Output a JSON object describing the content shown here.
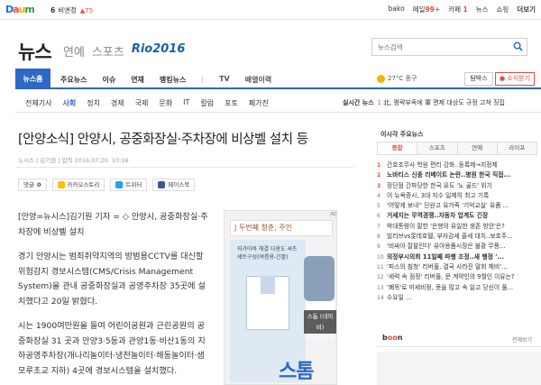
{
  "topbar": {
    "logo": {
      "d": "D",
      "a": "a",
      "u": "u",
      "m": "m"
    },
    "rank_num": "6",
    "rank_text": "비엔정",
    "rank_change": "▲75",
    "nav": [
      "bako",
      "메일",
      "99+",
      "카페",
      "1",
      "뉴스",
      "쇼핑",
      "더보기"
    ]
  },
  "header": {
    "brand": "뉴스",
    "sections": [
      "연예",
      "스포츠",
      "Rio2016"
    ],
    "search_placeholder": "뉴스검색"
  },
  "mainnav": {
    "home": "뉴스홈",
    "items": [
      "주요뉴스",
      "이슈",
      "연재",
      "랭킹뉴스",
      "|",
      "TV",
      "배열이력"
    ],
    "weather": "27°C 중구",
    "box_btn": "탐박스",
    "live_btn": "● 소식받기"
  },
  "subnav": {
    "items": [
      "전체기사",
      "사회",
      "정치",
      "경제",
      "국제",
      "문화",
      "IT",
      "칼럼",
      "포토",
      "페가진"
    ],
    "live_label": "실시간 뉴스",
    "live_num": "1",
    "live_text": "北, 평략부족에 軍 면제 대상도 규정 고쳐 징집"
  },
  "article": {
    "title": "[안양소식] 안양시, 공중화장실·주차장에 비상벨 설치 등",
    "meta": "뉴시스 | 김기원 | 입력 2016.07.20. 10:16",
    "share": {
      "comment": "댓글",
      "comment_count": "0",
      "kakao": "카카오스토리",
      "twitter": "트위터",
      "facebook": "페이스북"
    },
    "paragraphs": [
      "[안양=뉴시스]김기원 기자 = ◇ 안양시, 공중화장실·주차장에 비상벨 설치",
      "경기 안양시는 범죄취약지역의 방범용CCTV를 대신할 위험감지 경보시스템(CMS/Crisis Management System)을 관내 공중화장실과 공영주차장 35곳에 설치했다고 20일 밝혔다.",
      "시는 1900여만원을 들여 어린이공원과 근린공원의 공중화장실 31 곳과 안양3·5동과 관양1동·비산1동의 지하공영주차장(개나리놀이터·냉천놀이터·해동놀이터·샘모루초교 지하) 4곳에 경보시스템을 설치했다."
    ]
  },
  "ad": {
    "badge": "AD",
    "banner_a": "J",
    "banner_b": "두번째 청춘, 주인",
    "shirt_label_1": "자가아바 해결 다용도 셔츠",
    "shirt_label_2": "세트구성(여름용-긴팔)",
    "price_1": "스톰 (네이비)",
    "price_2": "42,800 원",
    "big_text": "스톰"
  },
  "rightpanel": {
    "heading": "이시각 주요뉴스",
    "tabs": [
      "종합",
      "스포츠",
      "연예",
      "라이프"
    ],
    "items": [
      {
        "n": "1",
        "t": "간호조무사 학원 편리 강화..등록제→지정제"
      },
      {
        "n": "2",
        "t": "노바티스 신종 리베이트 논란..병원 한국 직접..."
      },
      {
        "n": "3",
        "t": "장단점 간파당한 한국 유도 '노 골드' 위기"
      },
      {
        "n": "4",
        "t": "이 뉴욕증시, 3대 지수 일제히 최고 기록"
      },
      {
        "n": "5",
        "t": "'어떻게 보내'' 단원고 유가족 '기억교실' 유품 ..."
      },
      {
        "n": "6",
        "t": "거세지는 무역경쟁..자동차 업계도 긴장"
      },
      {
        "n": "7",
        "t": "박대통령이 말한 '은행의 유일한 생존 방안'은?"
      },
      {
        "n": "8",
        "t": "빌리브vs롯데호텔, 부자감세 줄세 대치..보호주..."
      },
      {
        "n": "9",
        "t": "'비싸야 잘팔린다' 유아용품시장은 불황 무풍..."
      },
      {
        "n": "10",
        "t": "의정부시의회 11일째 파행 조정..새 행정 '..."
      },
      {
        "n": "11",
        "t": "'피스의 침청' 리버풀, 결국 사라진 말회 제비'..."
      },
      {
        "n": "12",
        "t": "'세력 속 점정' 리버풀, 문 계약인의 9월인 이유는?"
      },
      {
        "n": "13",
        "t": "'폐목'로 미세비정, 못을 많고 속 잃고 당신이 풀..."
      },
      {
        "n": "14",
        "t": "수요일 ..."
      }
    ],
    "boon_logo": "b",
    "boon_logo_o": "oo",
    "boon_logo_n": "n",
    "boon_all": "전체보기"
  }
}
